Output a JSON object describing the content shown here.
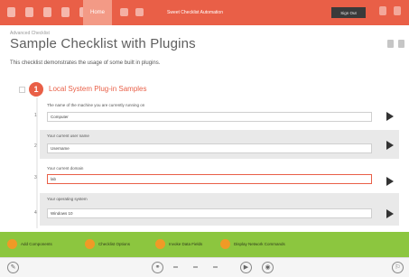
{
  "titlebar": {
    "tab_label": "Home",
    "window_title": "Sweet Checklist Automation",
    "dark_button_label": "Sign Out"
  },
  "header": {
    "breadcrumb": "Advanced Checklist",
    "title": "Sample Checklist with Plugins",
    "description": "This checklist demonstrates the usage of some built in plugins."
  },
  "section": {
    "number": "1",
    "title": "Local System Plug-in Samples"
  },
  "items": [
    {
      "number": "1",
      "label": "The name of the machine you are currently running on",
      "value": "Computer"
    },
    {
      "number": "2",
      "label": "Your current user name",
      "value": "Username"
    },
    {
      "number": "3",
      "label": "Your current domain",
      "value": "lab"
    },
    {
      "number": "4",
      "label": "Your operating system",
      "value": "Windows 10"
    }
  ],
  "plugins": [
    {
      "label": "Add Components"
    },
    {
      "label": "Checklist Options"
    },
    {
      "label": "Invoke Data Fields"
    },
    {
      "label": "Display Network Commands"
    }
  ],
  "colors": {
    "accent": "#e95f47",
    "plugin_bar": "#8cc63f",
    "plugin_dot": "#f09a26"
  }
}
